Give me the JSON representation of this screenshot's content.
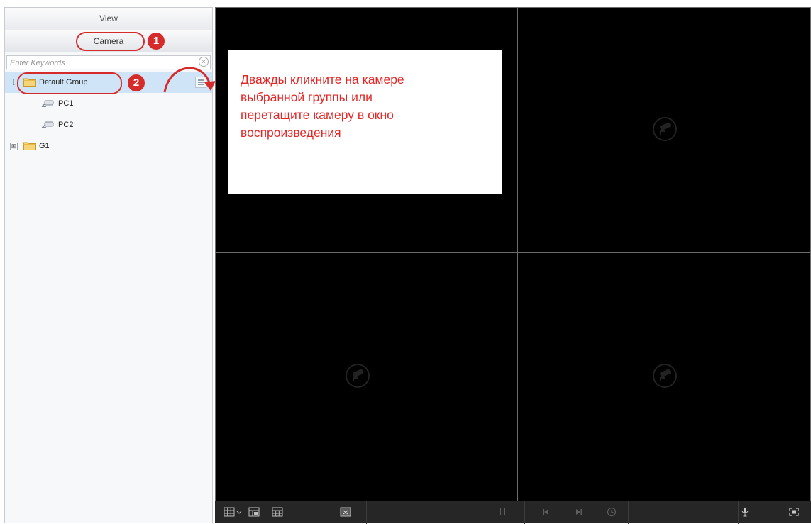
{
  "sidebar": {
    "view_label": "View",
    "camera_tab_label": "Camera",
    "search_placeholder": "Enter Keywords",
    "tree": {
      "default_group": "Default Group",
      "cameras": [
        "IPC1",
        "IPC2"
      ],
      "group2": "G1",
      "expand_symbol": "⊞"
    }
  },
  "annotations": {
    "step1": "1",
    "step2": "2",
    "callout": "Дважды кликните на камере\nвыбранной группы или\nперетащите камеру в окно\nвоспроизведения",
    "accent_color": "#d62b2b"
  },
  "video": {
    "pane_icon": "camera-icon",
    "toolbar_icons": [
      "layout-grid-icon",
      "layout-dropdown-icon",
      "window-add-icon",
      "window-grid-icon",
      "snapshot-icon",
      "pause-icon",
      "prev-frame-icon",
      "next-frame-icon",
      "clock-icon",
      "microphone-icon",
      "fullscreen-icon"
    ]
  }
}
